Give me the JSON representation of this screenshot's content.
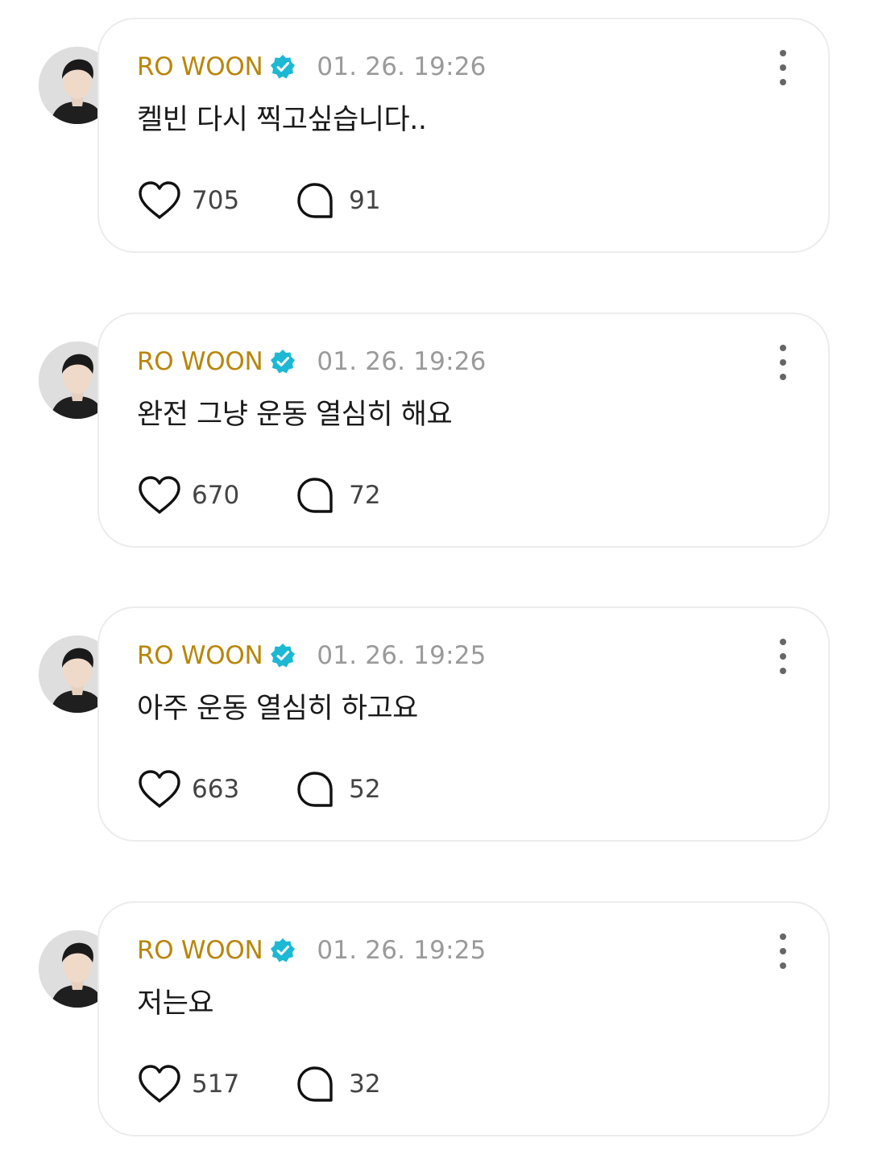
{
  "posts": [
    {
      "author": "RO WOON",
      "time": "01. 26. 19:26",
      "text": "켈빈 다시 찍고싶습니다..",
      "likes": "705",
      "comments": "91"
    },
    {
      "author": "RO WOON",
      "time": "01. 26. 19:26",
      "text": "완전 그냥 운동 열심히 해요",
      "likes": "670",
      "comments": "72"
    },
    {
      "author": "RO WOON",
      "time": "01. 26. 19:25",
      "text": "아주 운동 열심히 하고요",
      "likes": "663",
      "comments": "52"
    },
    {
      "author": "RO WOON",
      "time": "01. 26. 19:25",
      "text": "저는요",
      "likes": "517",
      "comments": "32"
    }
  ],
  "icons": {
    "verified": "verified-badge-icon",
    "more": "more-vertical-icon",
    "like": "heart-icon",
    "comment": "comment-bubble-icon"
  },
  "colors": {
    "author": "#b8860b",
    "verified": "#1cb8d4",
    "timestamp": "#9a9a9a",
    "card_border": "#ececec"
  }
}
